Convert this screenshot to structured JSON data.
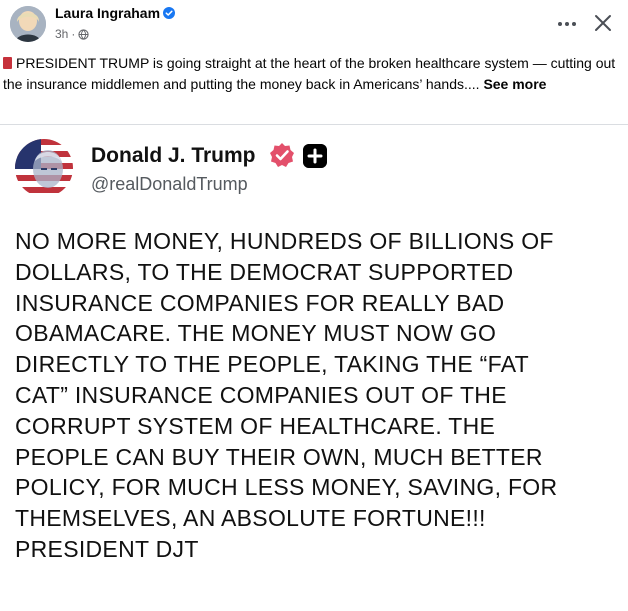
{
  "post": {
    "author": "Laura Ingraham",
    "time": "3h",
    "separator": "·",
    "caption": "PRESIDENT TRUMP is going straight at the heart of the broken healthcare system — cutting out the insurance middlemen and putting the money back in Americans’ hands.... ",
    "see_more": "See more",
    "more_icon": "more-horizontal-icon",
    "close_icon": "close-icon",
    "colors": {
      "text": "#050505",
      "meta": "#65676b",
      "verified": "#1877f2"
    }
  },
  "truth": {
    "name": "Donald J. Trump",
    "handle": "@realDonaldTrump",
    "body": "NO MORE MONEY, HUNDREDS OF BILLIONS OF\nDOLLARS, TO THE DEMOCRAT SUPPORTED\nINSURANCE COMPANIES FOR REALLY BAD\nOBAMACARE. THE MONEY MUST NOW GO\nDIRECTLY TO THE PEOPLE, TAKING THE “FAT\nCAT” INSURANCE COMPANIES OUT OF THE\nCORRUPT SYSTEM OF HEALTHCARE. THE\nPEOPLE CAN BUY THEIR OWN, MUCH BETTER\nPOLICY, FOR MUCH LESS MONEY, SAVING, FOR\nTHEMSELVES, AN ABSOLUTE FORTUNE!!!\nPRESIDENT DJT",
    "colors": {
      "verified": "#e3506b",
      "badge": "#000000"
    }
  }
}
